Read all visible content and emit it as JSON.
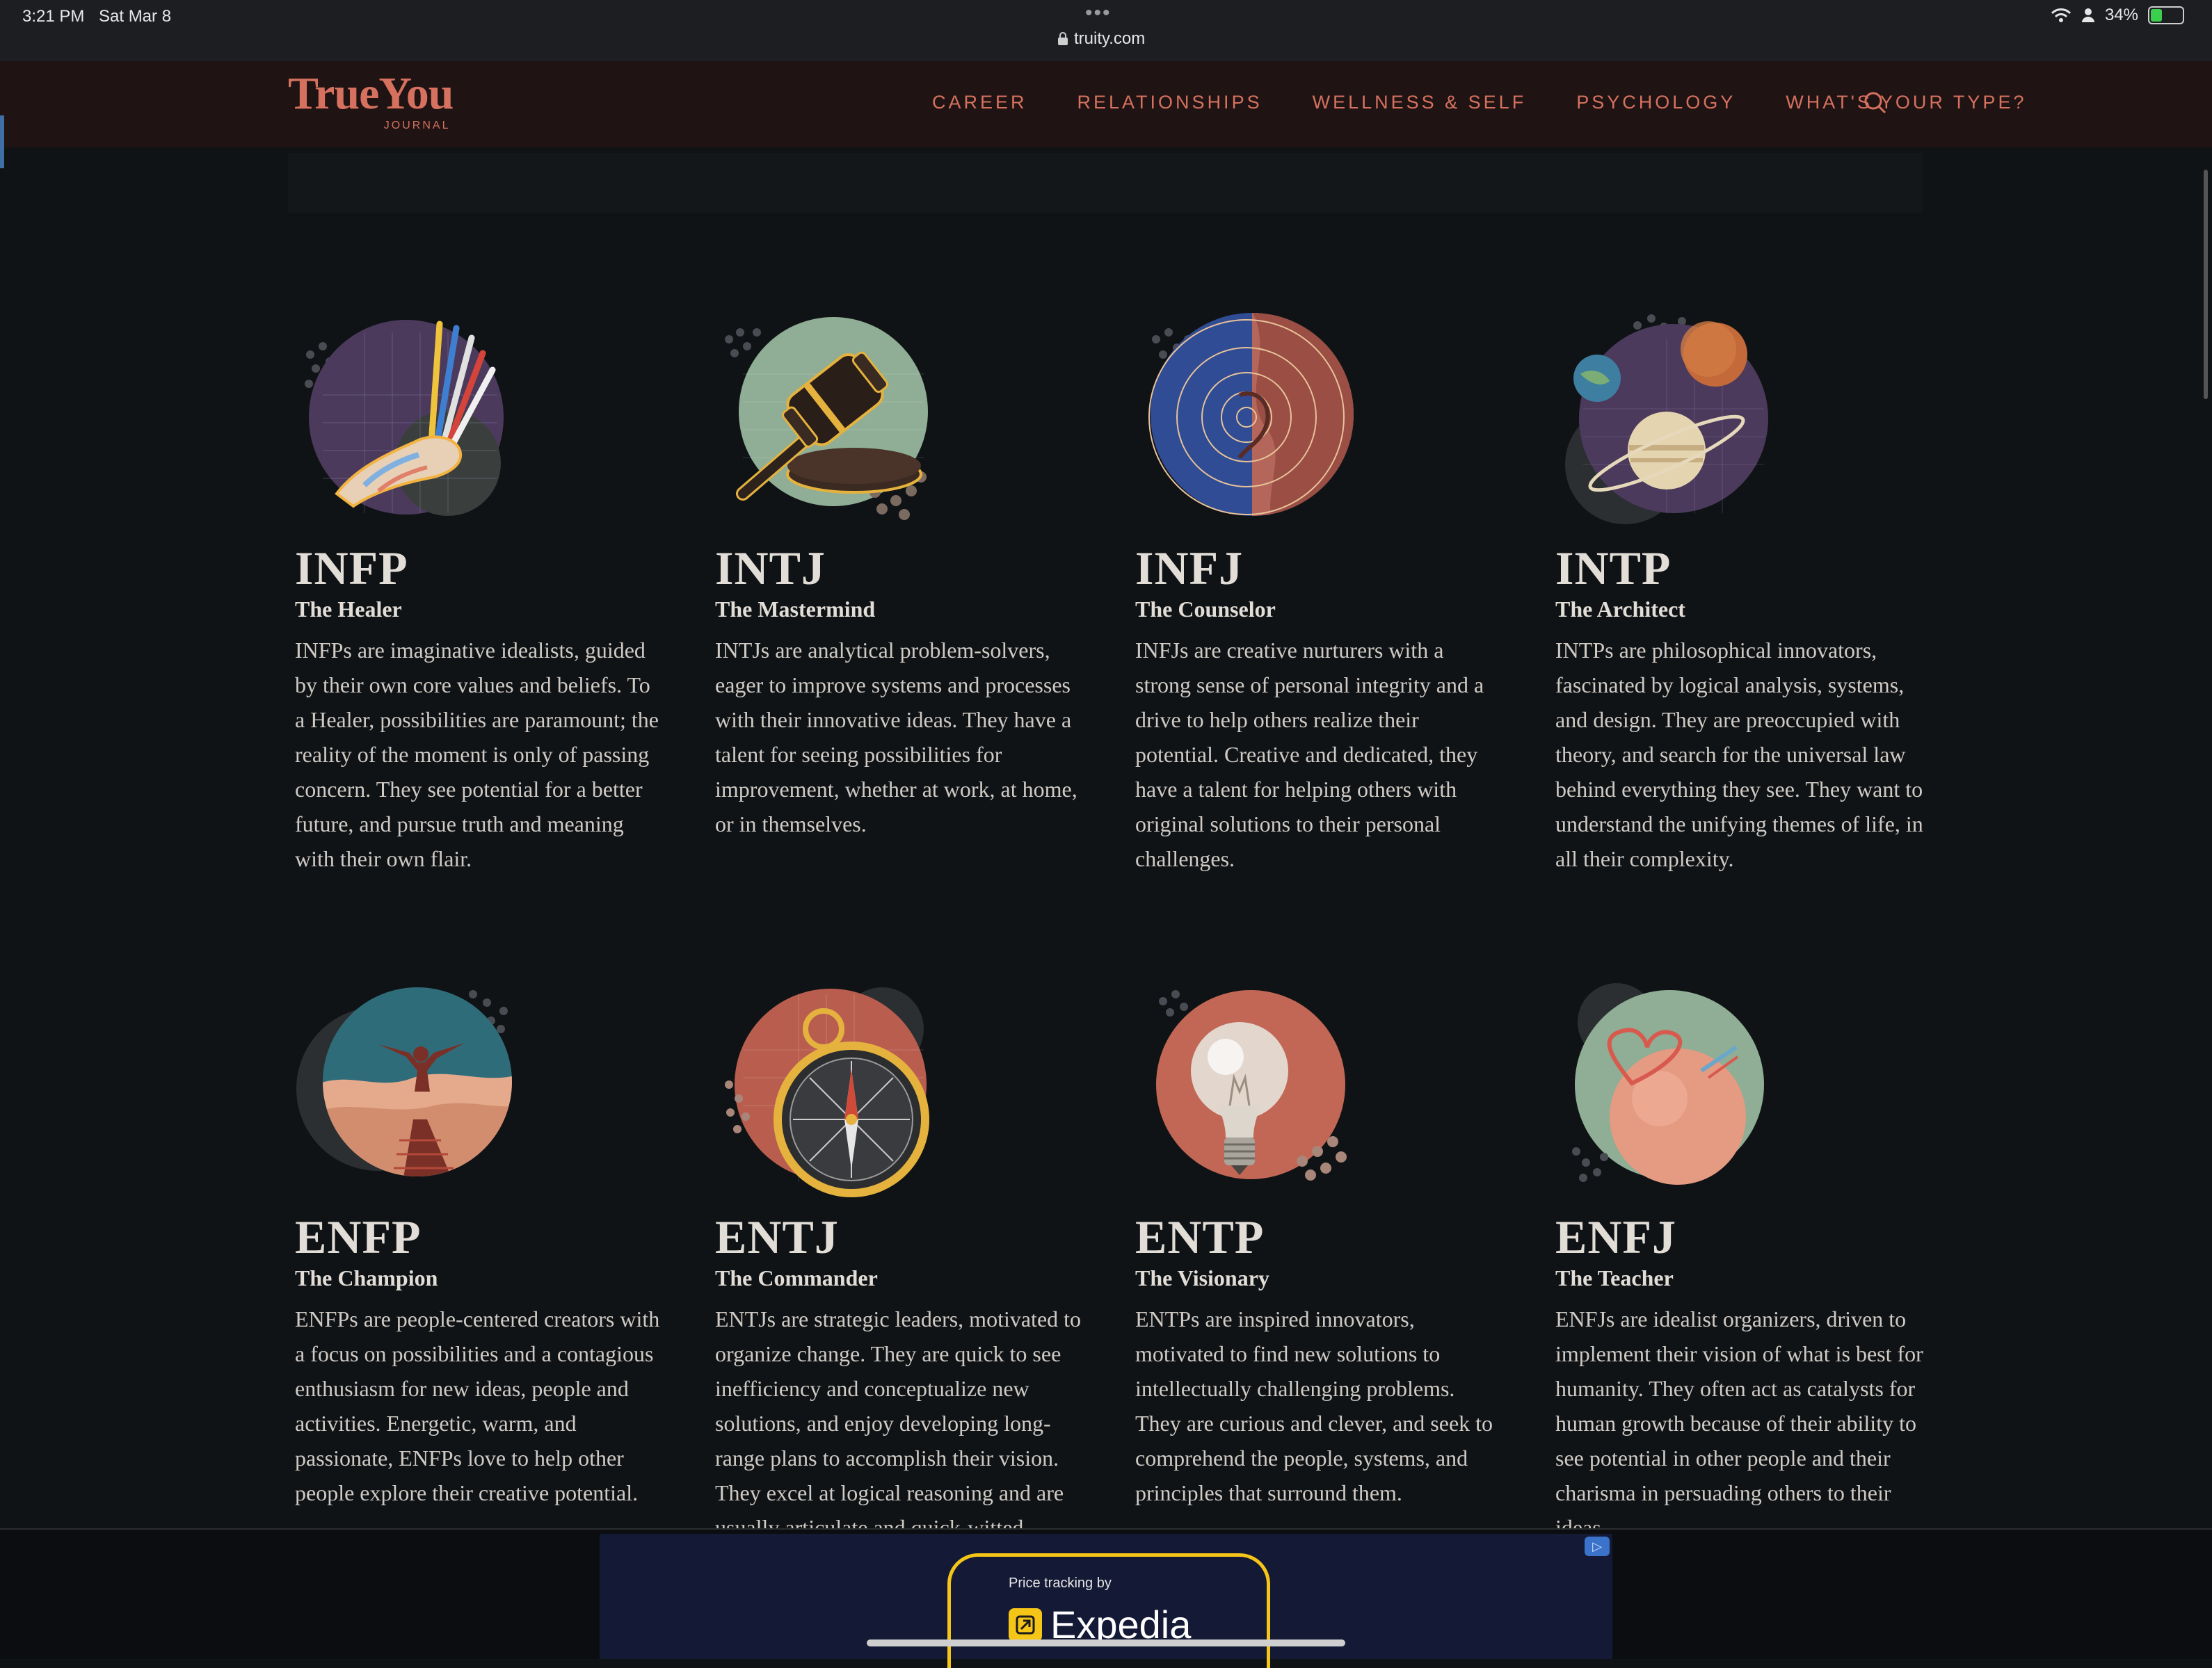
{
  "status_bar": {
    "time": "3:21 PM",
    "date": "Sat Mar 8",
    "url": "truity.com",
    "battery": "34%",
    "battery_level": 0.34
  },
  "nav": {
    "logo_main": "TrueYou",
    "logo_sub": "JOURNAL",
    "menu": [
      "CAREER",
      "RELATIONSHIPS",
      "WELLNESS & SELF",
      "PSYCHOLOGY",
      "WHAT'S YOUR TYPE?"
    ]
  },
  "colors": {
    "accent": "#d6715f",
    "background": "#101316",
    "nav_background": "#1f1413"
  },
  "types": [
    {
      "code": "INFP",
      "title": "The Healer",
      "icon": "paintbrushes-hand-icon",
      "description": "INFPs are imaginative idealists, guided by their own core values and beliefs. To a Healer, possibilities are paramount; the reality of the moment is only of passing concern. They see potential for a better future, and pursue truth and meaning with their own flair."
    },
    {
      "code": "INTJ",
      "title": "The Mastermind",
      "icon": "gavel-icon",
      "description": "INTJs are analytical problem-solvers, eager to improve systems and processes with their innovative ideas. They have a talent for seeing possibilities for improvement, whether at work, at home, or in themselves."
    },
    {
      "code": "INFJ",
      "title": "The Counselor",
      "icon": "ear-icon",
      "description": "INFJs are creative nurturers with a strong sense of personal integrity and a drive to help others realize their potential. Creative and dedicated, they have a talent for helping others with original solutions to their personal challenges."
    },
    {
      "code": "INTP",
      "title": "The Architect",
      "icon": "planets-icon",
      "description": "INTPs are philosophical innovators, fascinated by logical analysis, systems, and design. They are preoccupied with theory, and search for the universal law behind everything they see. They want to understand the unifying themes of life, in all their complexity."
    },
    {
      "code": "ENFP",
      "title": "The Champion",
      "icon": "person-arms-raised-icon",
      "description": "ENFPs are people-centered creators with a focus on possibilities and a contagious enthusiasm for new ideas, people and activities. Energetic, warm, and passionate, ENFPs love to help other people explore their creative potential."
    },
    {
      "code": "ENTJ",
      "title": "The Commander",
      "icon": "compass-icon",
      "description": "ENTJs are strategic leaders, motivated to organize change. They are quick to see inefficiency and conceptualize new solutions, and enjoy developing long-range plans to accomplish their vision. They excel at logical reasoning and are usually articulate and quick-witted."
    },
    {
      "code": "ENTP",
      "title": "The Visionary",
      "icon": "lightbulb-icon",
      "description": "ENTPs are inspired innovators, motivated to find new solutions to intellectually challenging problems. They are curious and clever, and seek to comprehend the people, systems, and principles that surround them."
    },
    {
      "code": "ENFJ",
      "title": "The Teacher",
      "icon": "heart-peach-icon",
      "description": "ENFJs are idealist organizers, driven to implement their vision of what is best for humanity. They often act as catalysts for human growth because of their ability to see potential in other people and their charisma in persuading others to their ideas."
    }
  ],
  "ad": {
    "tagline": "Price tracking by",
    "brand": "Expedia"
  }
}
